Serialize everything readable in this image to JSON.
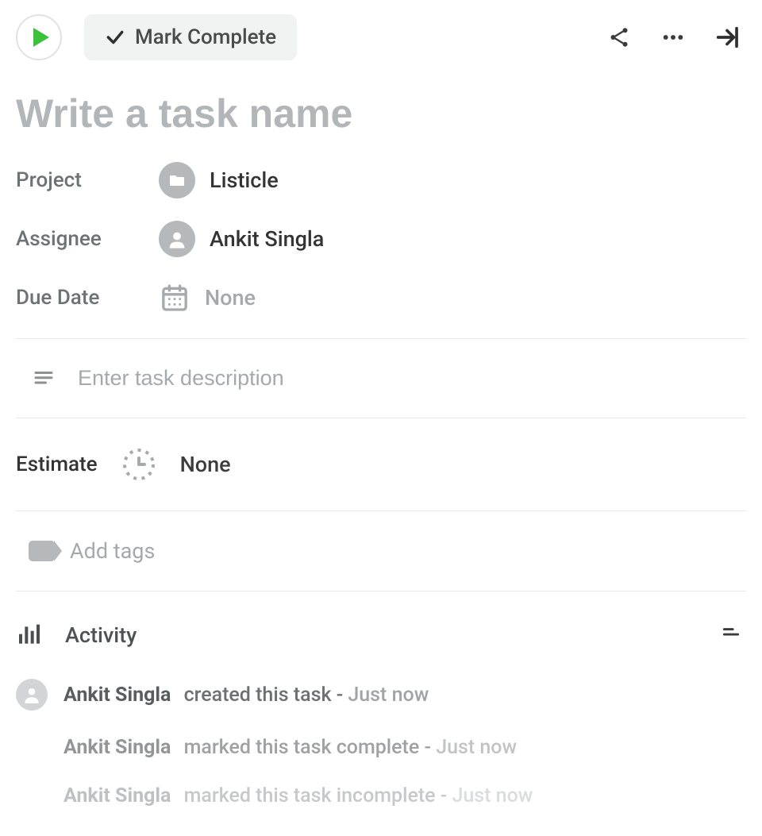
{
  "toolbar": {
    "mark_complete_label": "Mark Complete"
  },
  "task_name": {
    "value": "",
    "placeholder": "Write a task name"
  },
  "fields": {
    "project": {
      "label": "Project",
      "value": "Listicle"
    },
    "assignee": {
      "label": "Assignee",
      "value": "Ankit Singla"
    },
    "due_date": {
      "label": "Due Date",
      "value": "None"
    }
  },
  "description": {
    "value": "",
    "placeholder": "Enter task description"
  },
  "estimate": {
    "label": "Estimate",
    "value": "None"
  },
  "tags": {
    "placeholder": "Add tags"
  },
  "activity": {
    "header_label": "Activity",
    "items": [
      {
        "actor": "Ankit Singla",
        "action": "created this task -",
        "timestamp": "Just now"
      },
      {
        "actor": "Ankit Singla",
        "action": "marked this task complete -",
        "timestamp": "Just now"
      },
      {
        "actor": "Ankit Singla",
        "action": "marked this task incomplete -",
        "timestamp": "Just now"
      }
    ]
  }
}
